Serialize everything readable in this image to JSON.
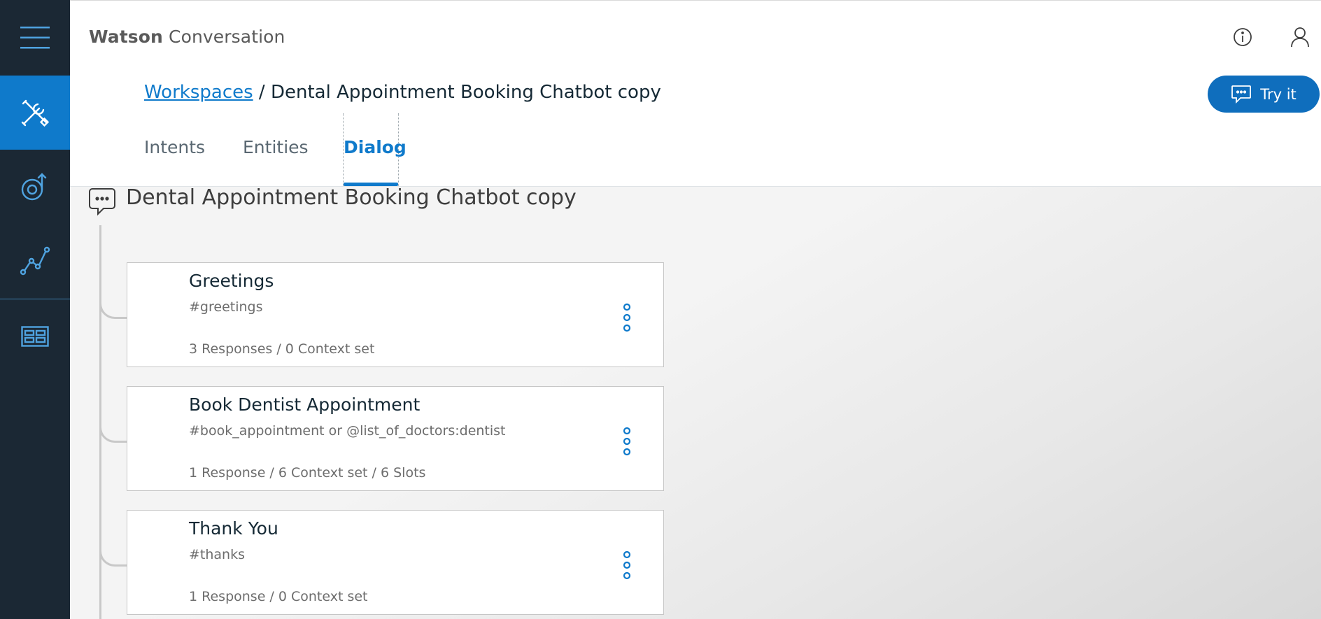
{
  "app": {
    "brand_bold": "Watson",
    "brand_rest": " Conversation"
  },
  "rail": {
    "items": [
      {
        "name": "menu",
        "icon": "hamburger-menu-icon"
      },
      {
        "name": "build",
        "icon": "tools-icon",
        "active": true
      },
      {
        "name": "improve",
        "icon": "improve-icon"
      },
      {
        "name": "deploy",
        "icon": "deploy-icon"
      },
      {
        "name": "content",
        "icon": "content-catalog-icon"
      }
    ],
    "active_color": "#0f7acb",
    "background": "#1b2834"
  },
  "header": {
    "info_icon": "info-icon",
    "user_icon": "user-icon"
  },
  "breadcrumb": {
    "link": "Workspaces",
    "separator": " / ",
    "current": "Dental Appointment Booking Chatbot copy"
  },
  "try_button": {
    "label": "Try it",
    "icon": "chat-icon",
    "color": "#0f6ebd"
  },
  "tabs": [
    {
      "label": "Intents",
      "active": false
    },
    {
      "label": "Entities",
      "active": false
    },
    {
      "label": "Dialog",
      "active": true
    }
  ],
  "dialog": {
    "root_title": "Dental Appointment Booking Chatbot copy",
    "root_icon": "chat-bubble-icon",
    "nodes": [
      {
        "title": "Greetings",
        "condition": "#greetings",
        "meta": "3 Responses / 0 Context set"
      },
      {
        "title": "Book Dentist Appointment",
        "condition": "#book_appointment or @list_of_doctors:dentist",
        "meta": "1 Response / 6 Context set / 6 Slots"
      },
      {
        "title": "Thank You",
        "condition": "#thanks",
        "meta": "1 Response / 0 Context set"
      }
    ]
  }
}
